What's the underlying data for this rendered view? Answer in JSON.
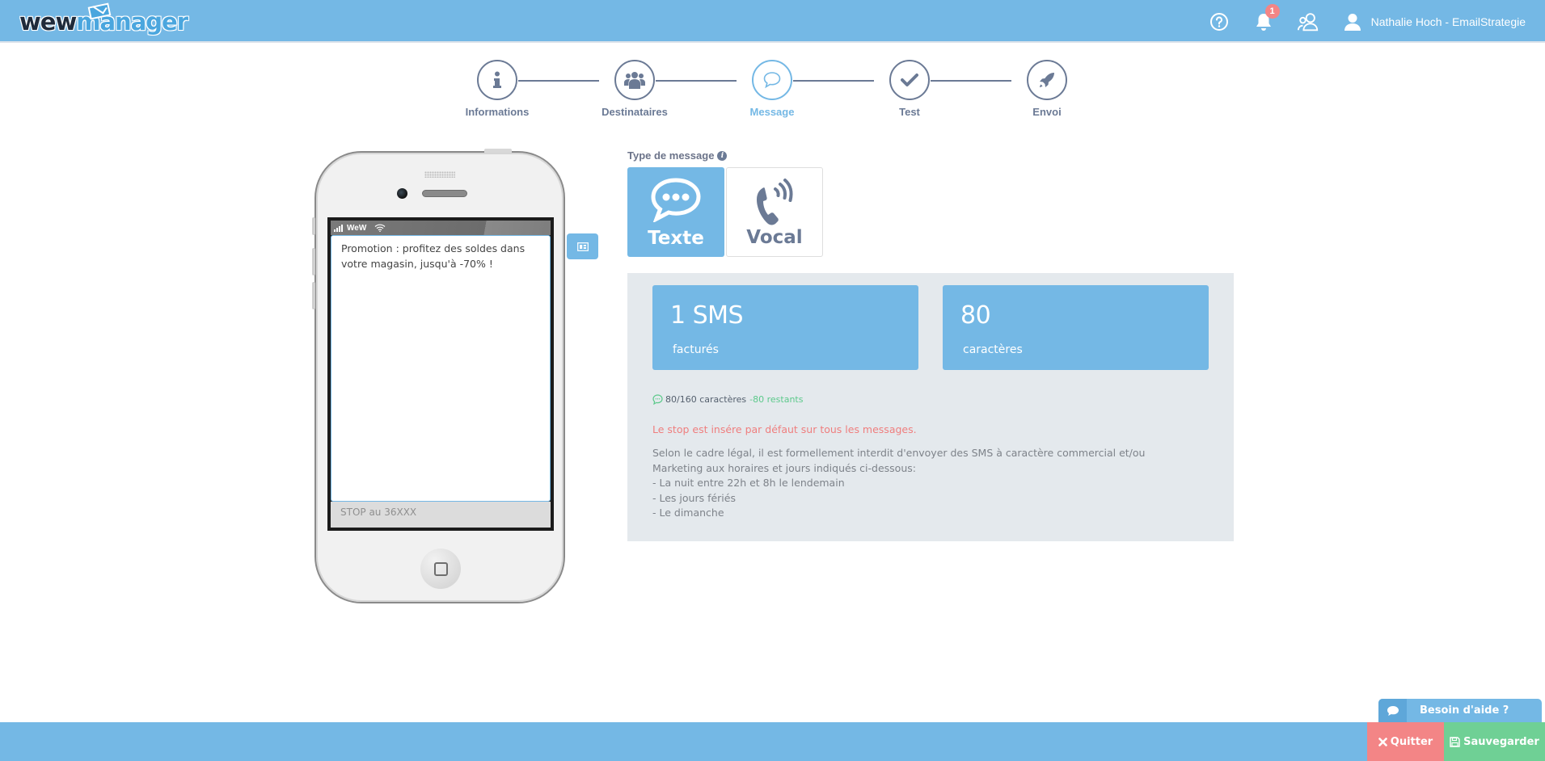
{
  "header": {
    "logo": {
      "part1": "wew",
      "part2": "manager"
    },
    "notifications_count": "1",
    "user_label": "Nathalie Hoch - EmailStrategie",
    "icons": [
      "help-icon",
      "bell-icon",
      "users-icon",
      "user-icon"
    ]
  },
  "stepper": {
    "steps": [
      {
        "label": "Informations",
        "icon": "info-icon",
        "active": false
      },
      {
        "label": "Destinataires",
        "icon": "group-icon",
        "active": false
      },
      {
        "label": "Message",
        "icon": "speech-bubble-icon",
        "active": true
      },
      {
        "label": "Test",
        "icon": "check-icon",
        "active": false
      },
      {
        "label": "Envoi",
        "icon": "rocket-icon",
        "active": false
      }
    ]
  },
  "phone": {
    "carrier": "WeW",
    "message_text": "Promotion : profitez des soldes dans votre magasin, jusqu'à -70% !",
    "stop_text": "STOP au 36XXX"
  },
  "message_type": {
    "label": "Type de message",
    "options": [
      {
        "label": "Texte",
        "icon": "speech-bubble-icon",
        "selected": true
      },
      {
        "label": "Vocal",
        "icon": "phone-call-icon",
        "selected": false
      }
    ]
  },
  "stats": {
    "sms": {
      "value": "1 SMS",
      "caption": "facturés"
    },
    "chars": {
      "value": "80",
      "caption": "caractères"
    }
  },
  "counter": {
    "text": "80/160 caractères",
    "remaining": "-80 restants"
  },
  "stop_warning": "Le stop est insére par défaut sur tous les messages.",
  "legal": {
    "intro": "Selon le cadre légal, il est formellement interdit d'envoyer des SMS à caractère commercial et/ou Marketing aux horaires et jours indiqués ci-dessous:",
    "items": [
      "- La nuit entre 22h et 8h le lendemain",
      "- Les jours fériés",
      "- Le dimanche"
    ]
  },
  "footer": {
    "help_label": "Besoin d'aide ?",
    "quit_label": "Quitter",
    "save_label": "Sauvegarder"
  },
  "colors": {
    "primary": "#74b8e5",
    "danger": "#f38586",
    "success": "#6fd095",
    "step_gray": "#6b7a95",
    "panel_bg": "#e4e9ed"
  }
}
